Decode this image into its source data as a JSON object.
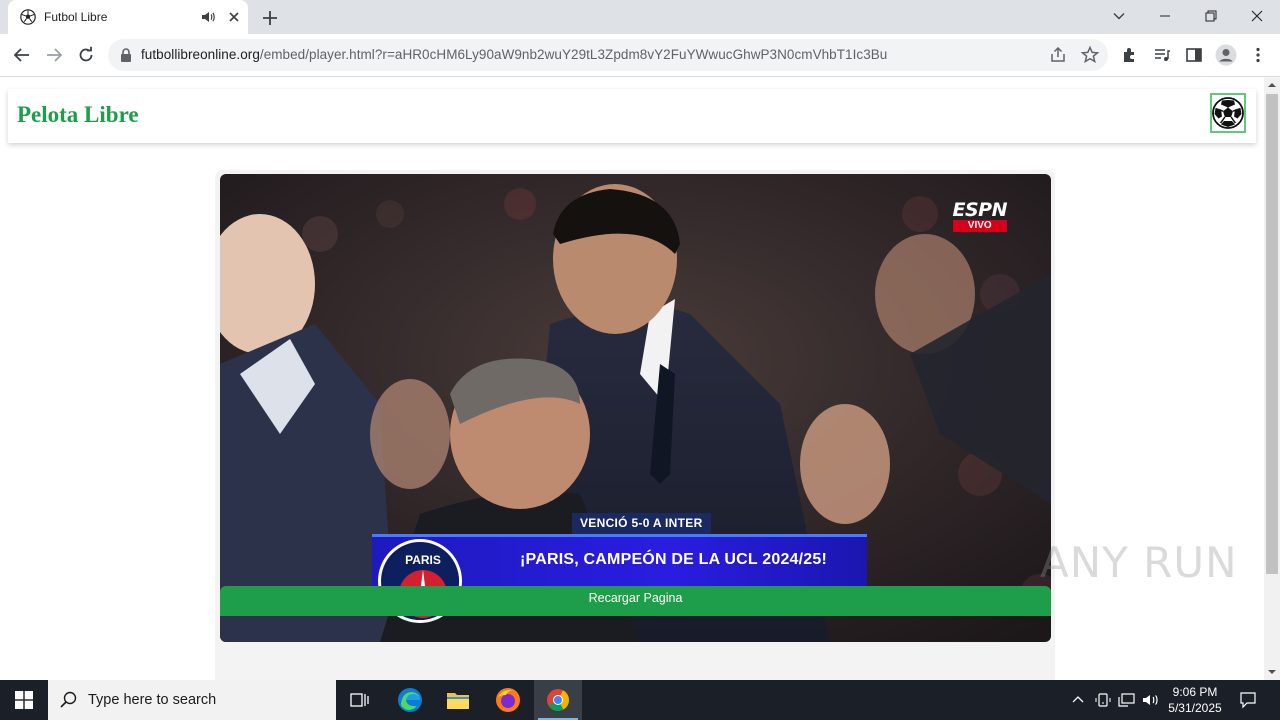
{
  "browser": {
    "tab_title": "Futbol Libre",
    "url_host": "futbollibreonline.org",
    "url_path": "/embed/player.html?r=aHR0cHM6Ly90aW9nb2wuY29tL3Zpdm8vY2FuYWwucGhwP3N0cmVhbT1Ic3Bu"
  },
  "site": {
    "logo": "Pelota Libre",
    "reload_button": "Recargar Pagina"
  },
  "video": {
    "broadcaster": "ESPN",
    "live_label": "VIVO",
    "result_tag": "VENCIÓ 5-0 A INTER",
    "headline": "¡PARIS, CAMPEÓN DE LA UCL 2024/25!",
    "badge_text": "PARIS"
  },
  "watermark": "ANY RUN",
  "taskbar": {
    "search_placeholder": "Type here to search",
    "time": "9:06 PM",
    "date": "5/31/2025"
  }
}
